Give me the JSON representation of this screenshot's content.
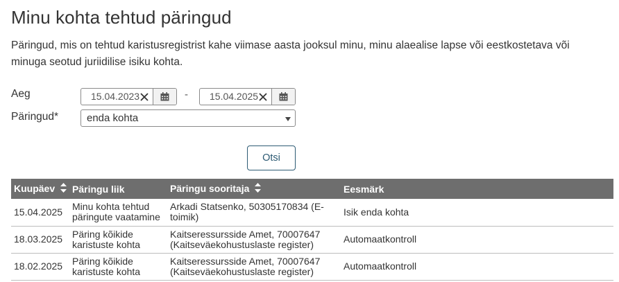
{
  "page": {
    "title": "Minu kohta tehtud päringud",
    "description": "Päringud, mis on tehtud karistusregistrist kahe viimase aasta jooksul minu, minu alaealise lapse või eestkostetava või minuga seotud juriidilise isiku kohta."
  },
  "filters": {
    "time_label": "Aeg",
    "date_from": "15.04.2023",
    "date_to": "15.04.2025",
    "separator": "-",
    "queries_label": "Päringud*",
    "queries_selected": "enda kohta",
    "search_label": "Otsi"
  },
  "table": {
    "headers": [
      "Kuupäev",
      "Päringu liik",
      "Päringu sooritaja",
      "Eesmärk"
    ],
    "rows": [
      {
        "date": "15.04.2025",
        "type": "Minu kohta tehtud päringute vaatamine",
        "performer": "Arkadi Statsenko, 50305170834 (E-toimik)",
        "purpose": "Isik enda kohta"
      },
      {
        "date": "18.03.2025",
        "type": "Päring kõikide karistuste kohta",
        "performer": "Kaitseressursside Amet, 70007647 (Kaitseväekohustuslaste register)",
        "purpose": "Automaatkontroll"
      },
      {
        "date": "18.02.2025",
        "type": "Päring kõikide karistuste kohta",
        "performer": "Kaitseressursside Amet, 70007647 (Kaitseväekohustuslaste register)",
        "purpose": "Automaatkontroll"
      }
    ]
  },
  "icons": {
    "clear": "close-icon",
    "calendar": "calendar-icon",
    "sort": "sort-icon",
    "dropdown": "chevron-down-icon"
  },
  "colors": {
    "header_bg": "#6e6e6e",
    "button_border": "#2c5a73"
  }
}
